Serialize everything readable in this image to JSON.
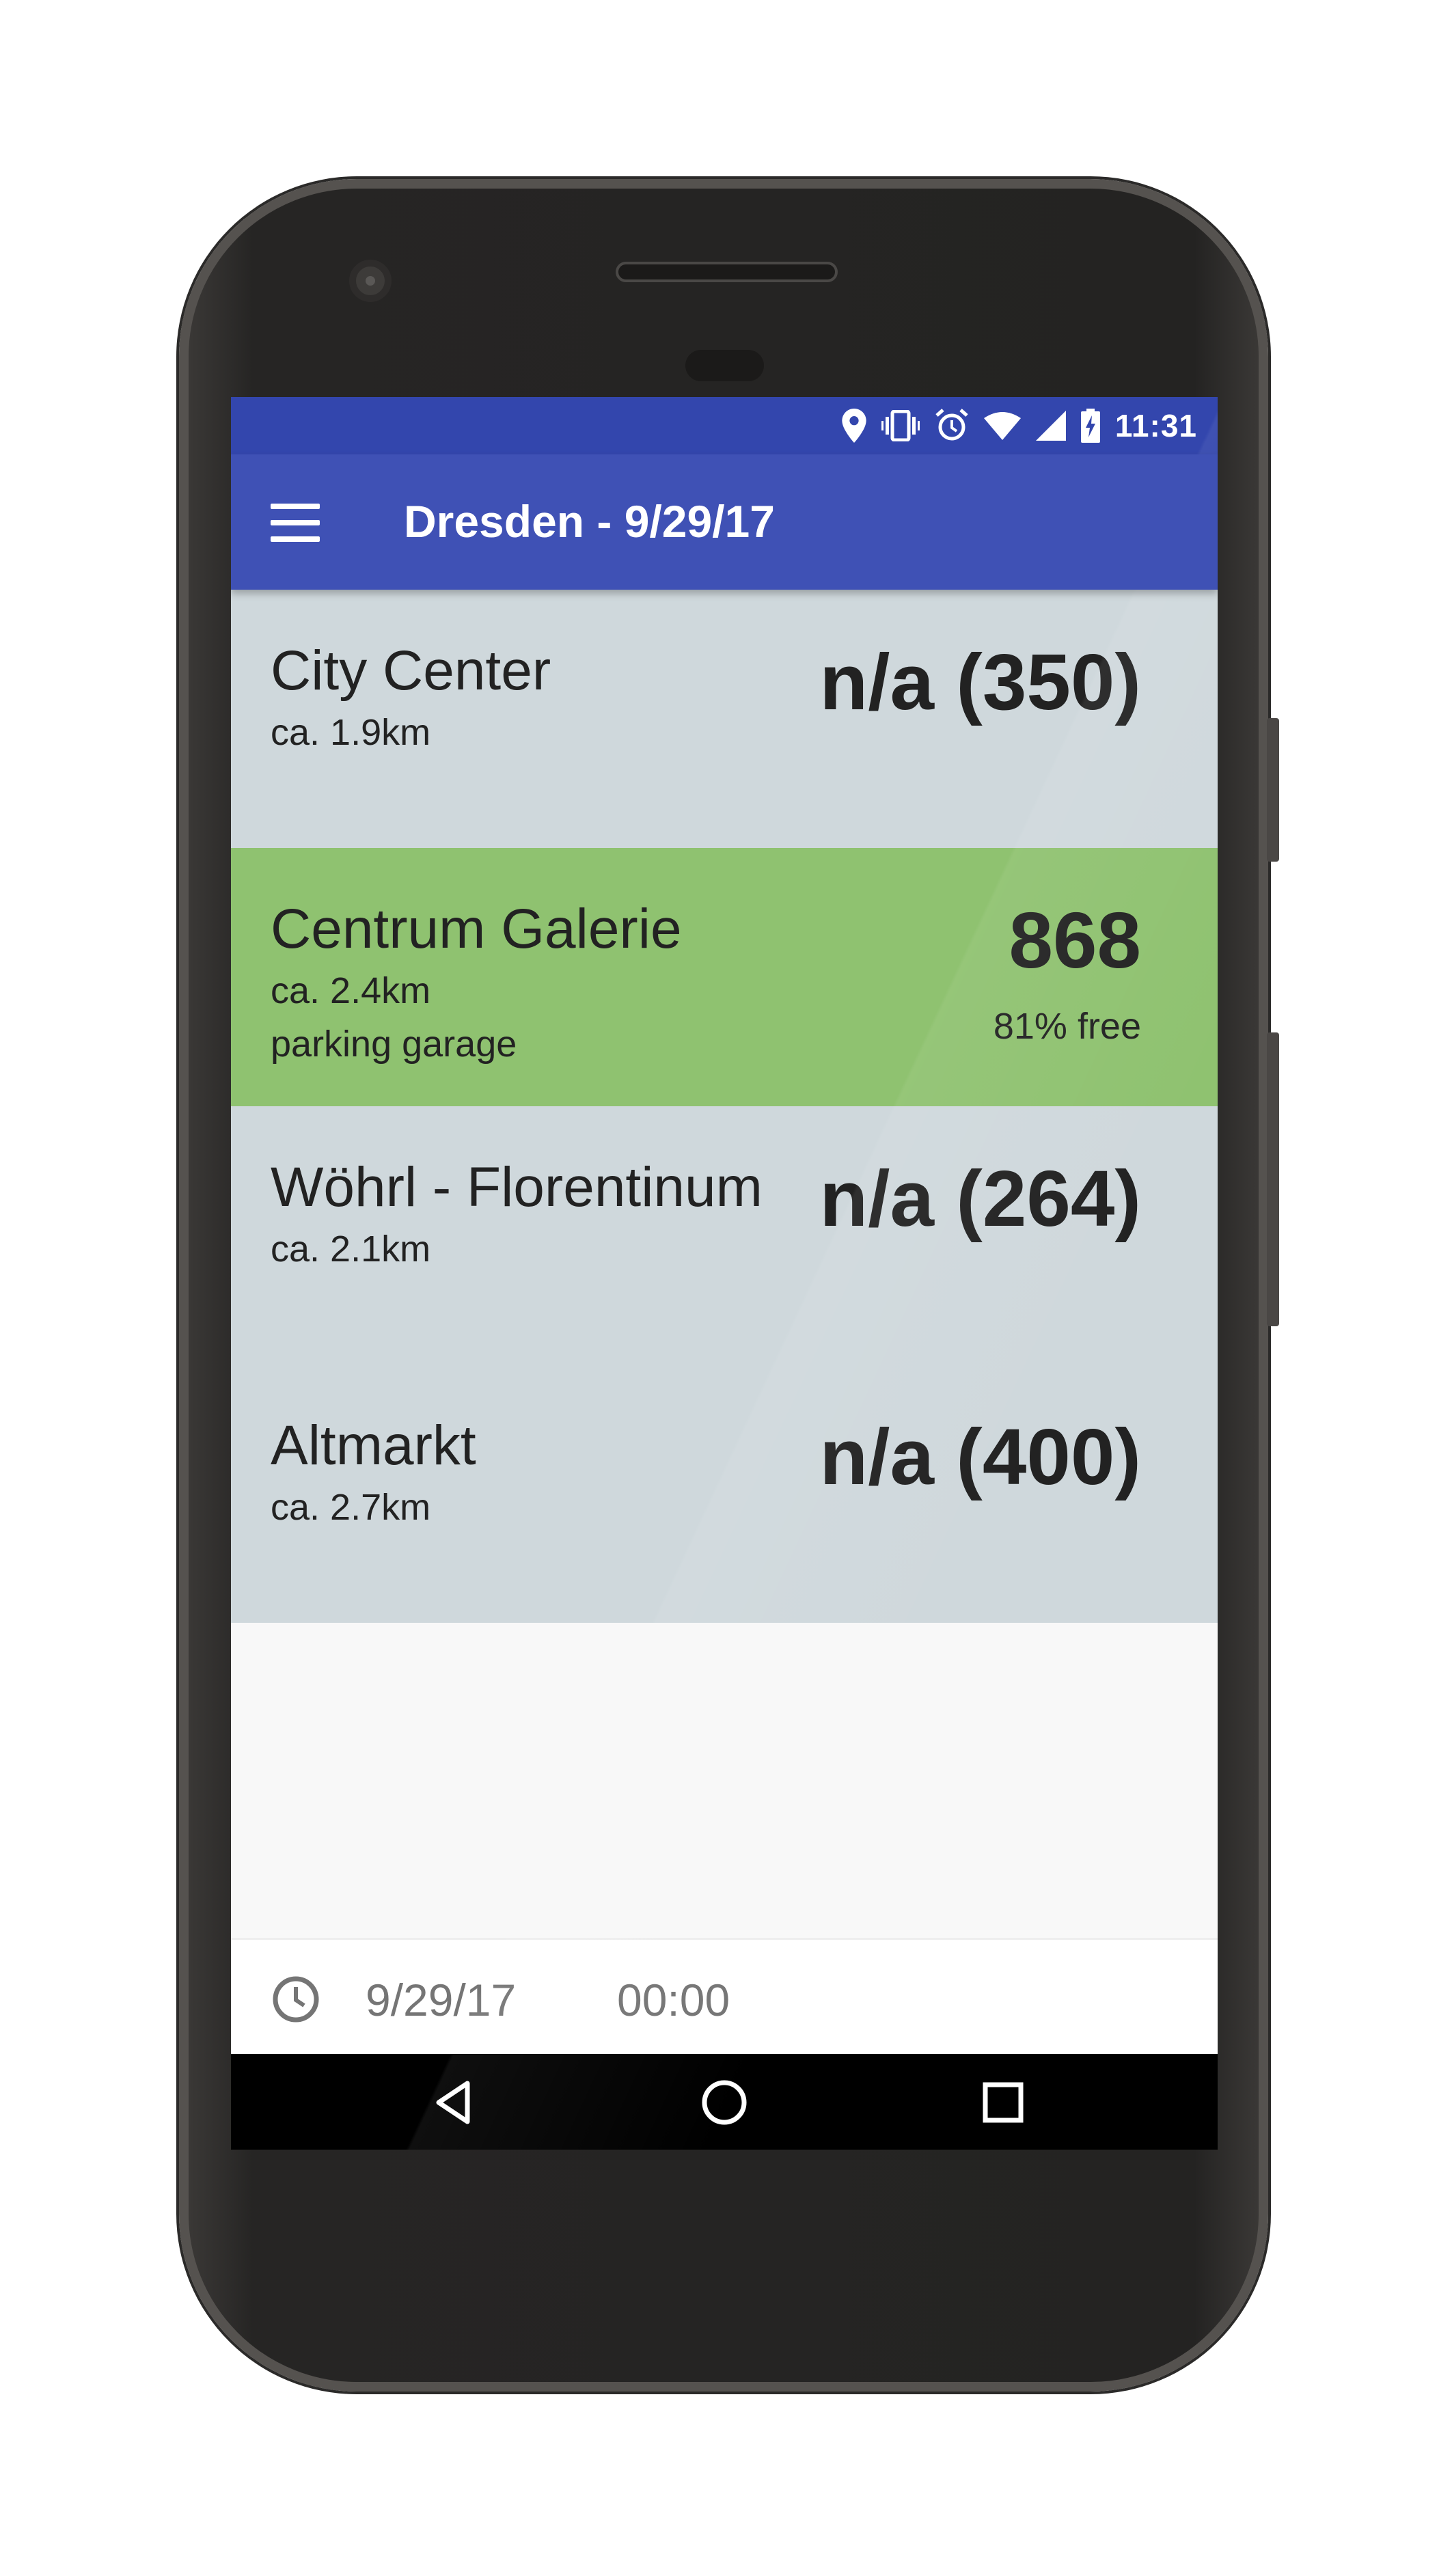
{
  "status_bar": {
    "time": "11:31",
    "icons": [
      "location-icon",
      "vibrate-icon",
      "alarm-icon",
      "wifi-icon",
      "signal-icon",
      "battery-charging-icon"
    ]
  },
  "app_bar": {
    "title": "Dresden - 9/29/17",
    "menu_icon": "menu-icon"
  },
  "parking_list": [
    {
      "name": "City Center",
      "distance": "ca. 1.9km",
      "type": "",
      "value": "n/a (350)",
      "free": "",
      "color": "#cfd8dc"
    },
    {
      "name": "Centrum Galerie",
      "distance": "ca. 2.4km",
      "type": "parking garage",
      "value": "868",
      "free": "81% free",
      "color": "#8fc270"
    },
    {
      "name": "Wöhrl - Florentinum",
      "distance": "ca. 2.1km",
      "type": "",
      "value": "n/a (264)",
      "free": "",
      "color": "#cfd8dc"
    },
    {
      "name": "Altmarkt",
      "distance": "ca. 2.7km",
      "type": "",
      "value": "n/a (400)",
      "free": "",
      "color": "#cfd8dc"
    }
  ],
  "bottom_bar": {
    "icon": "clock-icon",
    "date": "9/29/17",
    "time": "00:00"
  },
  "nav_bar": {
    "icons": [
      "back-icon",
      "home-icon",
      "recents-icon"
    ]
  },
  "colors": {
    "status_bar": "#3346ad",
    "app_bar": "#3f51b5",
    "row_default": "#cfd8dc",
    "row_highlight": "#8fc270"
  }
}
